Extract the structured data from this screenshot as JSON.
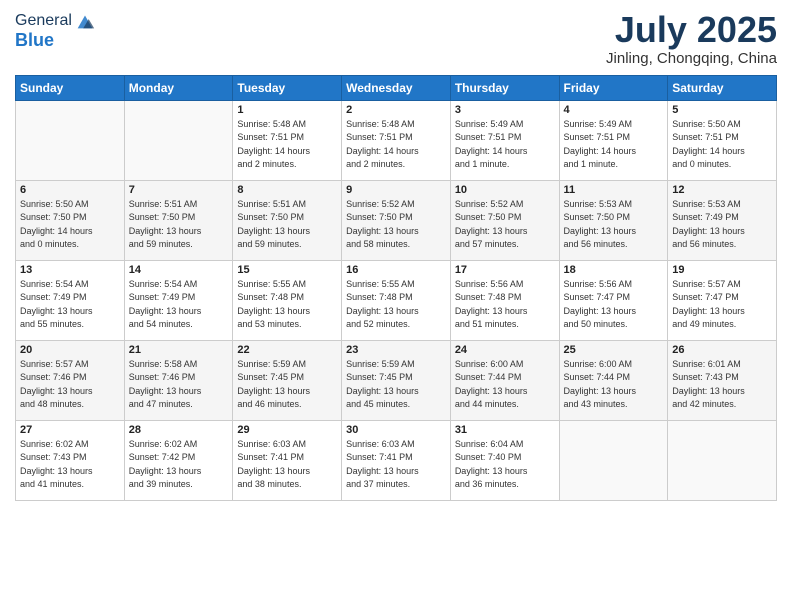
{
  "header": {
    "logo_line1": "General",
    "logo_line2": "Blue",
    "month": "July 2025",
    "location": "Jinling, Chongqing, China"
  },
  "weekdays": [
    "Sunday",
    "Monday",
    "Tuesday",
    "Wednesday",
    "Thursday",
    "Friday",
    "Saturday"
  ],
  "weeks": [
    [
      {
        "day": "",
        "detail": ""
      },
      {
        "day": "",
        "detail": ""
      },
      {
        "day": "1",
        "detail": "Sunrise: 5:48 AM\nSunset: 7:51 PM\nDaylight: 14 hours\nand 2 minutes."
      },
      {
        "day": "2",
        "detail": "Sunrise: 5:48 AM\nSunset: 7:51 PM\nDaylight: 14 hours\nand 2 minutes."
      },
      {
        "day": "3",
        "detail": "Sunrise: 5:49 AM\nSunset: 7:51 PM\nDaylight: 14 hours\nand 1 minute."
      },
      {
        "day": "4",
        "detail": "Sunrise: 5:49 AM\nSunset: 7:51 PM\nDaylight: 14 hours\nand 1 minute."
      },
      {
        "day": "5",
        "detail": "Sunrise: 5:50 AM\nSunset: 7:51 PM\nDaylight: 14 hours\nand 0 minutes."
      }
    ],
    [
      {
        "day": "6",
        "detail": "Sunrise: 5:50 AM\nSunset: 7:50 PM\nDaylight: 14 hours\nand 0 minutes."
      },
      {
        "day": "7",
        "detail": "Sunrise: 5:51 AM\nSunset: 7:50 PM\nDaylight: 13 hours\nand 59 minutes."
      },
      {
        "day": "8",
        "detail": "Sunrise: 5:51 AM\nSunset: 7:50 PM\nDaylight: 13 hours\nand 59 minutes."
      },
      {
        "day": "9",
        "detail": "Sunrise: 5:52 AM\nSunset: 7:50 PM\nDaylight: 13 hours\nand 58 minutes."
      },
      {
        "day": "10",
        "detail": "Sunrise: 5:52 AM\nSunset: 7:50 PM\nDaylight: 13 hours\nand 57 minutes."
      },
      {
        "day": "11",
        "detail": "Sunrise: 5:53 AM\nSunset: 7:50 PM\nDaylight: 13 hours\nand 56 minutes."
      },
      {
        "day": "12",
        "detail": "Sunrise: 5:53 AM\nSunset: 7:49 PM\nDaylight: 13 hours\nand 56 minutes."
      }
    ],
    [
      {
        "day": "13",
        "detail": "Sunrise: 5:54 AM\nSunset: 7:49 PM\nDaylight: 13 hours\nand 55 minutes."
      },
      {
        "day": "14",
        "detail": "Sunrise: 5:54 AM\nSunset: 7:49 PM\nDaylight: 13 hours\nand 54 minutes."
      },
      {
        "day": "15",
        "detail": "Sunrise: 5:55 AM\nSunset: 7:48 PM\nDaylight: 13 hours\nand 53 minutes."
      },
      {
        "day": "16",
        "detail": "Sunrise: 5:55 AM\nSunset: 7:48 PM\nDaylight: 13 hours\nand 52 minutes."
      },
      {
        "day": "17",
        "detail": "Sunrise: 5:56 AM\nSunset: 7:48 PM\nDaylight: 13 hours\nand 51 minutes."
      },
      {
        "day": "18",
        "detail": "Sunrise: 5:56 AM\nSunset: 7:47 PM\nDaylight: 13 hours\nand 50 minutes."
      },
      {
        "day": "19",
        "detail": "Sunrise: 5:57 AM\nSunset: 7:47 PM\nDaylight: 13 hours\nand 49 minutes."
      }
    ],
    [
      {
        "day": "20",
        "detail": "Sunrise: 5:57 AM\nSunset: 7:46 PM\nDaylight: 13 hours\nand 48 minutes."
      },
      {
        "day": "21",
        "detail": "Sunrise: 5:58 AM\nSunset: 7:46 PM\nDaylight: 13 hours\nand 47 minutes."
      },
      {
        "day": "22",
        "detail": "Sunrise: 5:59 AM\nSunset: 7:45 PM\nDaylight: 13 hours\nand 46 minutes."
      },
      {
        "day": "23",
        "detail": "Sunrise: 5:59 AM\nSunset: 7:45 PM\nDaylight: 13 hours\nand 45 minutes."
      },
      {
        "day": "24",
        "detail": "Sunrise: 6:00 AM\nSunset: 7:44 PM\nDaylight: 13 hours\nand 44 minutes."
      },
      {
        "day": "25",
        "detail": "Sunrise: 6:00 AM\nSunset: 7:44 PM\nDaylight: 13 hours\nand 43 minutes."
      },
      {
        "day": "26",
        "detail": "Sunrise: 6:01 AM\nSunset: 7:43 PM\nDaylight: 13 hours\nand 42 minutes."
      }
    ],
    [
      {
        "day": "27",
        "detail": "Sunrise: 6:02 AM\nSunset: 7:43 PM\nDaylight: 13 hours\nand 41 minutes."
      },
      {
        "day": "28",
        "detail": "Sunrise: 6:02 AM\nSunset: 7:42 PM\nDaylight: 13 hours\nand 39 minutes."
      },
      {
        "day": "29",
        "detail": "Sunrise: 6:03 AM\nSunset: 7:41 PM\nDaylight: 13 hours\nand 38 minutes."
      },
      {
        "day": "30",
        "detail": "Sunrise: 6:03 AM\nSunset: 7:41 PM\nDaylight: 13 hours\nand 37 minutes."
      },
      {
        "day": "31",
        "detail": "Sunrise: 6:04 AM\nSunset: 7:40 PM\nDaylight: 13 hours\nand 36 minutes."
      },
      {
        "day": "",
        "detail": ""
      },
      {
        "day": "",
        "detail": ""
      }
    ]
  ]
}
